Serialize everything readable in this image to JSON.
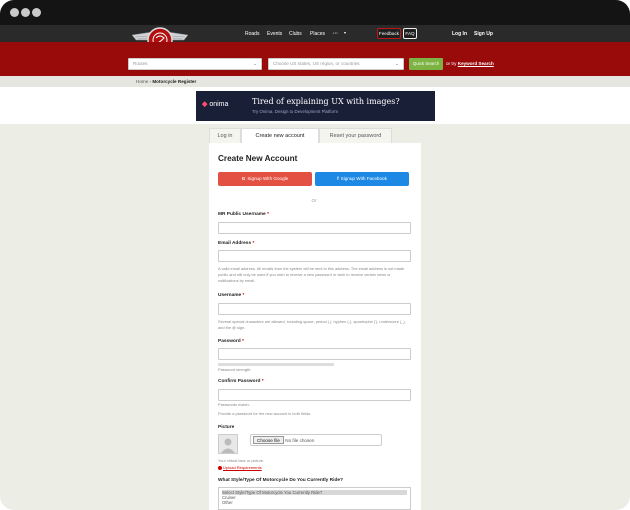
{
  "header": {
    "nav": [
      "Roads",
      "Events",
      "Clubs",
      "Places",
      "···"
    ],
    "feedback": "Feedback",
    "faq": "FAQ",
    "login": "Log In",
    "signup": "Sign Up"
  },
  "search": {
    "routes_placeholder": "Routes",
    "region_placeholder": "Choose US states, US region, or countries",
    "quick_search": "Quick Search",
    "or_try": "or try",
    "keyword_search": "Keyword Search"
  },
  "breadcrumb": {
    "home": "Home",
    "sep": "›",
    "current": "Motorcycle Register"
  },
  "ad": {
    "brand": "onima",
    "headline": "Tired of explaining UX with images?",
    "sub": "Try Onima. Design to Development Platform"
  },
  "tabs": {
    "login": "Log in",
    "create": "Create new account",
    "reset": "Reset your password"
  },
  "form": {
    "title": "Create New Account",
    "google": "Signup With Google",
    "facebook": "Signup With Facebook",
    "or": "Or",
    "public_username": "MR Public Username",
    "email": "Email Address",
    "email_hint": "A valid email address. All emails from the system will be sent to this address. The email address is not made public and will only be used if you wish to receive a new password or wish to receive certain news or notifications by email.",
    "username": "Username",
    "username_hint": "Several special characters are allowed, including space, period (.), hyphen (-), apostrophe ('), underscore (_), and the @ sign.",
    "password": "Password",
    "password_strength": "Password strength:",
    "confirm_password": "Confirm Password",
    "passwords_match": "Passwords match:",
    "confirm_hint": "Provide a password for the new account in both fields.",
    "picture": "Picture",
    "choose_file": "Choose file",
    "no_file": "No file chosen",
    "picture_hint": "Your virtual face or picture.",
    "upload_req": "Upload Requirements",
    "style_q": "What Style/Type Of Motorcycle Do You Currently Ride?",
    "style_options": [
      "Select Style/Type Of Motorcycle You Currently Ride?",
      "Cruiser",
      "Other"
    ]
  },
  "colors": {
    "brand_red": "#990a0a",
    "google": "#e25141",
    "facebook": "#1e88e5",
    "quick_search": "#7cb342"
  }
}
